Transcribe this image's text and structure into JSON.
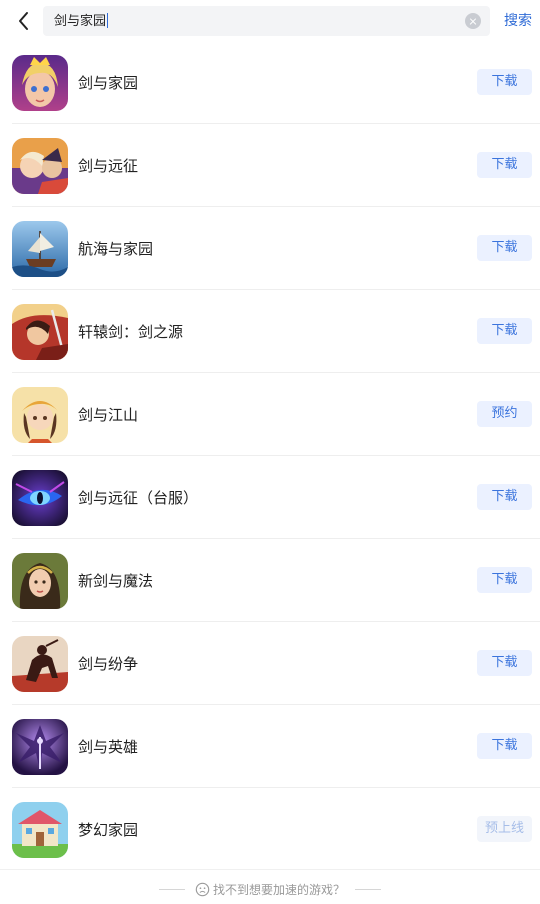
{
  "header": {
    "search_value": "剑与家园",
    "search_button": "搜索",
    "back_icon": "chevron-left-icon",
    "clear_icon": "clear-icon"
  },
  "results": [
    {
      "name": "剑与家园",
      "action": "下载",
      "state": "enabled"
    },
    {
      "name": "剑与远征",
      "action": "下载",
      "state": "enabled"
    },
    {
      "name": "航海与家园",
      "action": "下载",
      "state": "enabled"
    },
    {
      "name": "轩辕剑：剑之源",
      "action": "下载",
      "state": "enabled"
    },
    {
      "name": "剑与江山",
      "action": "预约",
      "state": "enabled"
    },
    {
      "name": "剑与远征（台服）",
      "action": "下载",
      "state": "enabled"
    },
    {
      "name": "新剑与魔法",
      "action": "下载",
      "state": "enabled"
    },
    {
      "name": "剑与纷争",
      "action": "下载",
      "state": "enabled"
    },
    {
      "name": "剑与英雄",
      "action": "下载",
      "state": "enabled"
    },
    {
      "name": "梦幻家园",
      "action": "预上线",
      "state": "disabled"
    }
  ],
  "footer": {
    "text": "找不到想要加速的游戏？",
    "icon": "sad-face-icon"
  },
  "colors": {
    "accent": "#3b74dd",
    "button_bg": "#ebf1ff",
    "disabled_text": "#a6bde8"
  }
}
